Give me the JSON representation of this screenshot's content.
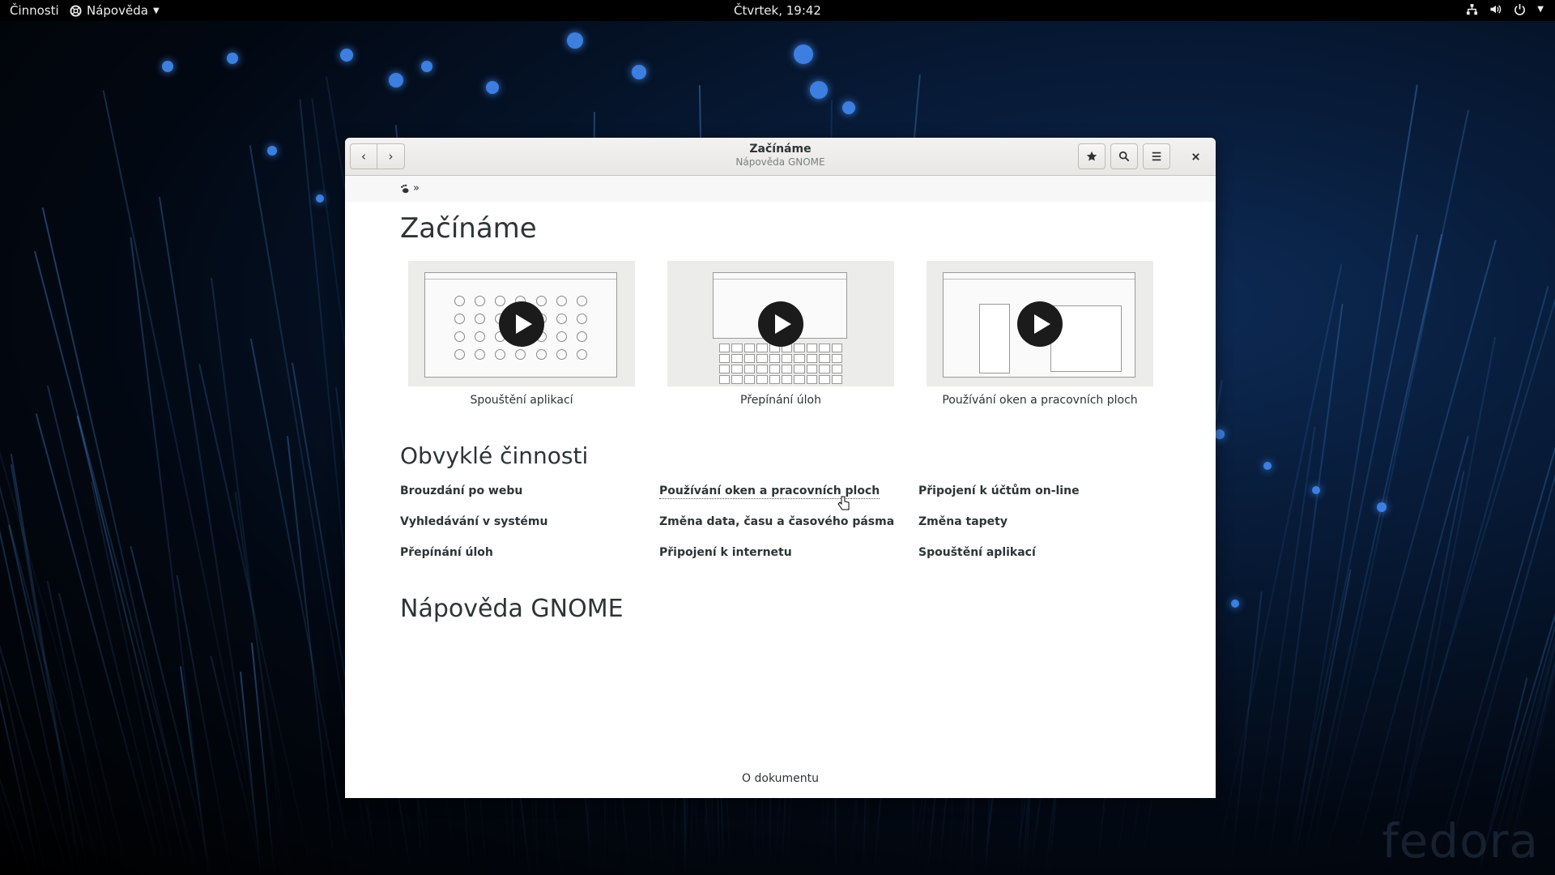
{
  "topbar": {
    "activities": "Činnosti",
    "app_menu": "Nápověda",
    "clock": "Čtvrtek, 19:42"
  },
  "window": {
    "title": "Začínáme",
    "subtitle": "Nápověda GNOME",
    "breadcrumb_sep": "»"
  },
  "page": {
    "heading": "Začínáme",
    "videos": [
      {
        "caption": "Spouštění aplikací"
      },
      {
        "caption": "Přepínání úloh"
      },
      {
        "caption": "Používání oken a pracovních ploch"
      }
    ],
    "tasks_heading": "Obvyklé činnosti",
    "tasks": [
      [
        "Brouzdání po webu",
        "Používání oken a pracovních ploch",
        "Připojení k účtům on-line"
      ],
      [
        "Vyhledávání v systému",
        "Změna data, času a časového pásma",
        "Změna tapety"
      ],
      [
        "Přepínání úloh",
        "Připojení k internetu",
        "Spouštění aplikací"
      ]
    ],
    "help_heading": "Nápověda GNOME",
    "footer_link": "O dokumentu"
  },
  "wallpaper": {
    "watermark": "fedora"
  }
}
